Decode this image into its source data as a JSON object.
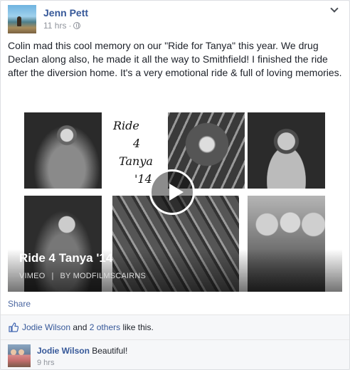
{
  "post": {
    "author": "Jenn Pett",
    "timestamp": "11 hrs",
    "separator": "·",
    "privacy_icon": "globe-icon",
    "options_icon": "chevron-down-icon",
    "text": "Colin mad this cool memory on our \"Ride for Tanya\" this year. We drug Declan along also, he made it all the way to Smithfield! I finished the ride after the diversion home. It's a very emotional ride & full of loving memories."
  },
  "video": {
    "art_lines": [
      "Ride",
      "4",
      "Tanya",
      "'14"
    ],
    "title": "Ride 4 Tanya '14",
    "source": "VIMEO",
    "sep": "|",
    "by": "BY MODFILMSCAIRNS",
    "play_icon": "play-icon"
  },
  "actions": {
    "share": "Share"
  },
  "likes": {
    "icon": "thumbs-up-icon",
    "name": "Jodie Wilson",
    "and": "and",
    "others": "2 others",
    "suffix": "like this."
  },
  "comment": {
    "author": "Jodie Wilson",
    "text": "Beautiful!",
    "time": "9 hrs"
  },
  "colors": {
    "link": "#365899",
    "muted": "#90949c",
    "bg": "#f6f7f9"
  }
}
